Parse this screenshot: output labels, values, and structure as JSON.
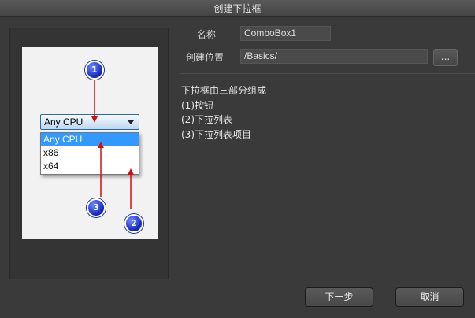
{
  "window": {
    "title": "创建下拉框"
  },
  "preview": {
    "combo_value": "Any CPU",
    "dropdown_items": [
      "Any CPU",
      "x86",
      "x64"
    ],
    "badges": [
      "1",
      "2",
      "3"
    ]
  },
  "form": {
    "name_label": "名称",
    "name_value": "ComboBox1",
    "location_label": "创建位置",
    "location_value": "/Basics/",
    "browse_label": "..."
  },
  "description": {
    "lines": [
      "下拉框由三部分组成",
      "(1)按钮",
      "(2)下拉列表",
      "(3)下拉列表项目"
    ]
  },
  "buttons": {
    "next": "下一步",
    "cancel": "取消"
  },
  "colors": {
    "annotation_arrow": "#cc1111",
    "badge": "#1224b8",
    "selected_item": "#3399ff"
  }
}
